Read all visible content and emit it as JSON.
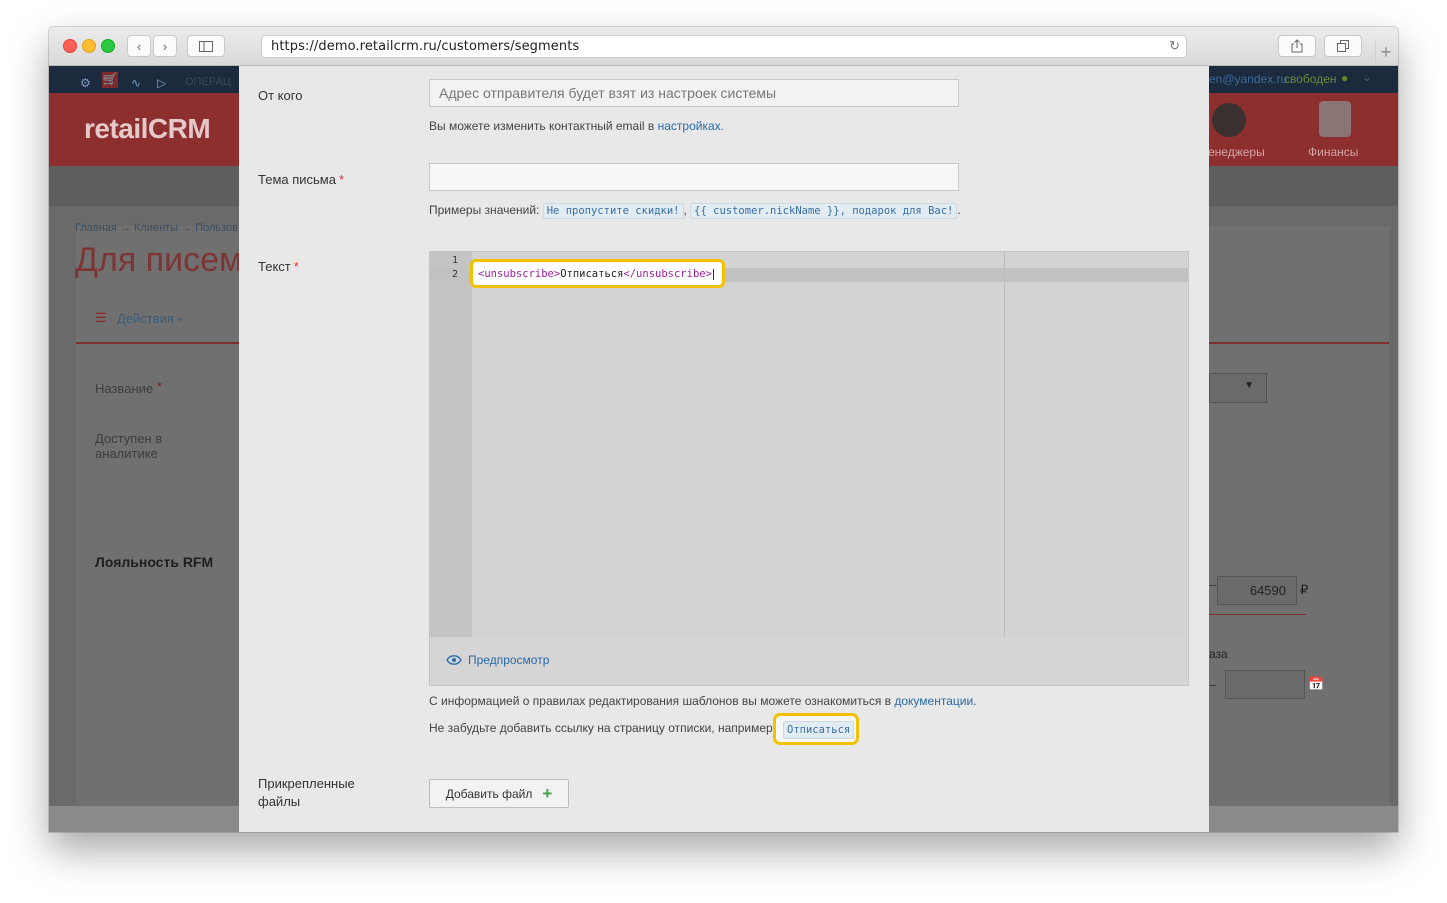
{
  "browser": {
    "url": "https://demo.retailcrm.ru/customers/segments"
  },
  "background": {
    "logo": "retailCRM",
    "breadcrumb": "Главная → Клиенты → Пользов",
    "page_title": "Для писем",
    "actions_label": "Действия",
    "name_label": "Название",
    "available_label": "Доступен в аналитике",
    "loyalty_title": "Лояльность RFM",
    "top_menu_item": "ОПЕРАЦ",
    "user_email": "en@yandex.ru",
    "user_status": "свободен",
    "managers_label": "енеджеры",
    "finance_label": "Финансы",
    "amount_value": "64590",
    "currency": "₽",
    "order_label": "аза"
  },
  "modal": {
    "from": {
      "label": "От кого",
      "placeholder": "Адрес отправителя будет взят из настроек системы",
      "help_text": "Вы можете изменить контактный email в",
      "help_link": "настройках."
    },
    "subject": {
      "label": "Тема письма",
      "required_mark": "*",
      "value": "",
      "examples_label": "Примеры значений:",
      "example_1": "Не пропустите скидки!",
      "example_2": "{{ customer.nickName }}, подарок для Вас!"
    },
    "text": {
      "label": "Текст",
      "required_mark": "*",
      "line_1": "1",
      "line_2": "2",
      "code_open": "<unsubscribe>",
      "code_text": "Отписаться",
      "code_close": "</unsubscribe>",
      "preview_label": "Предпросмотр"
    },
    "docs_text": "С информацией о правилах редактирования шаблонов вы можете ознакомиться в",
    "docs_link": "документации.",
    "unsub_text": "Не забудьте добавить ссылку на страницу отписки, например",
    "unsub_chip": "Отписаться",
    "attachments": {
      "label_1": "Прикрепленные",
      "label_2": "файлы",
      "add_button": "Добавить файл"
    }
  }
}
